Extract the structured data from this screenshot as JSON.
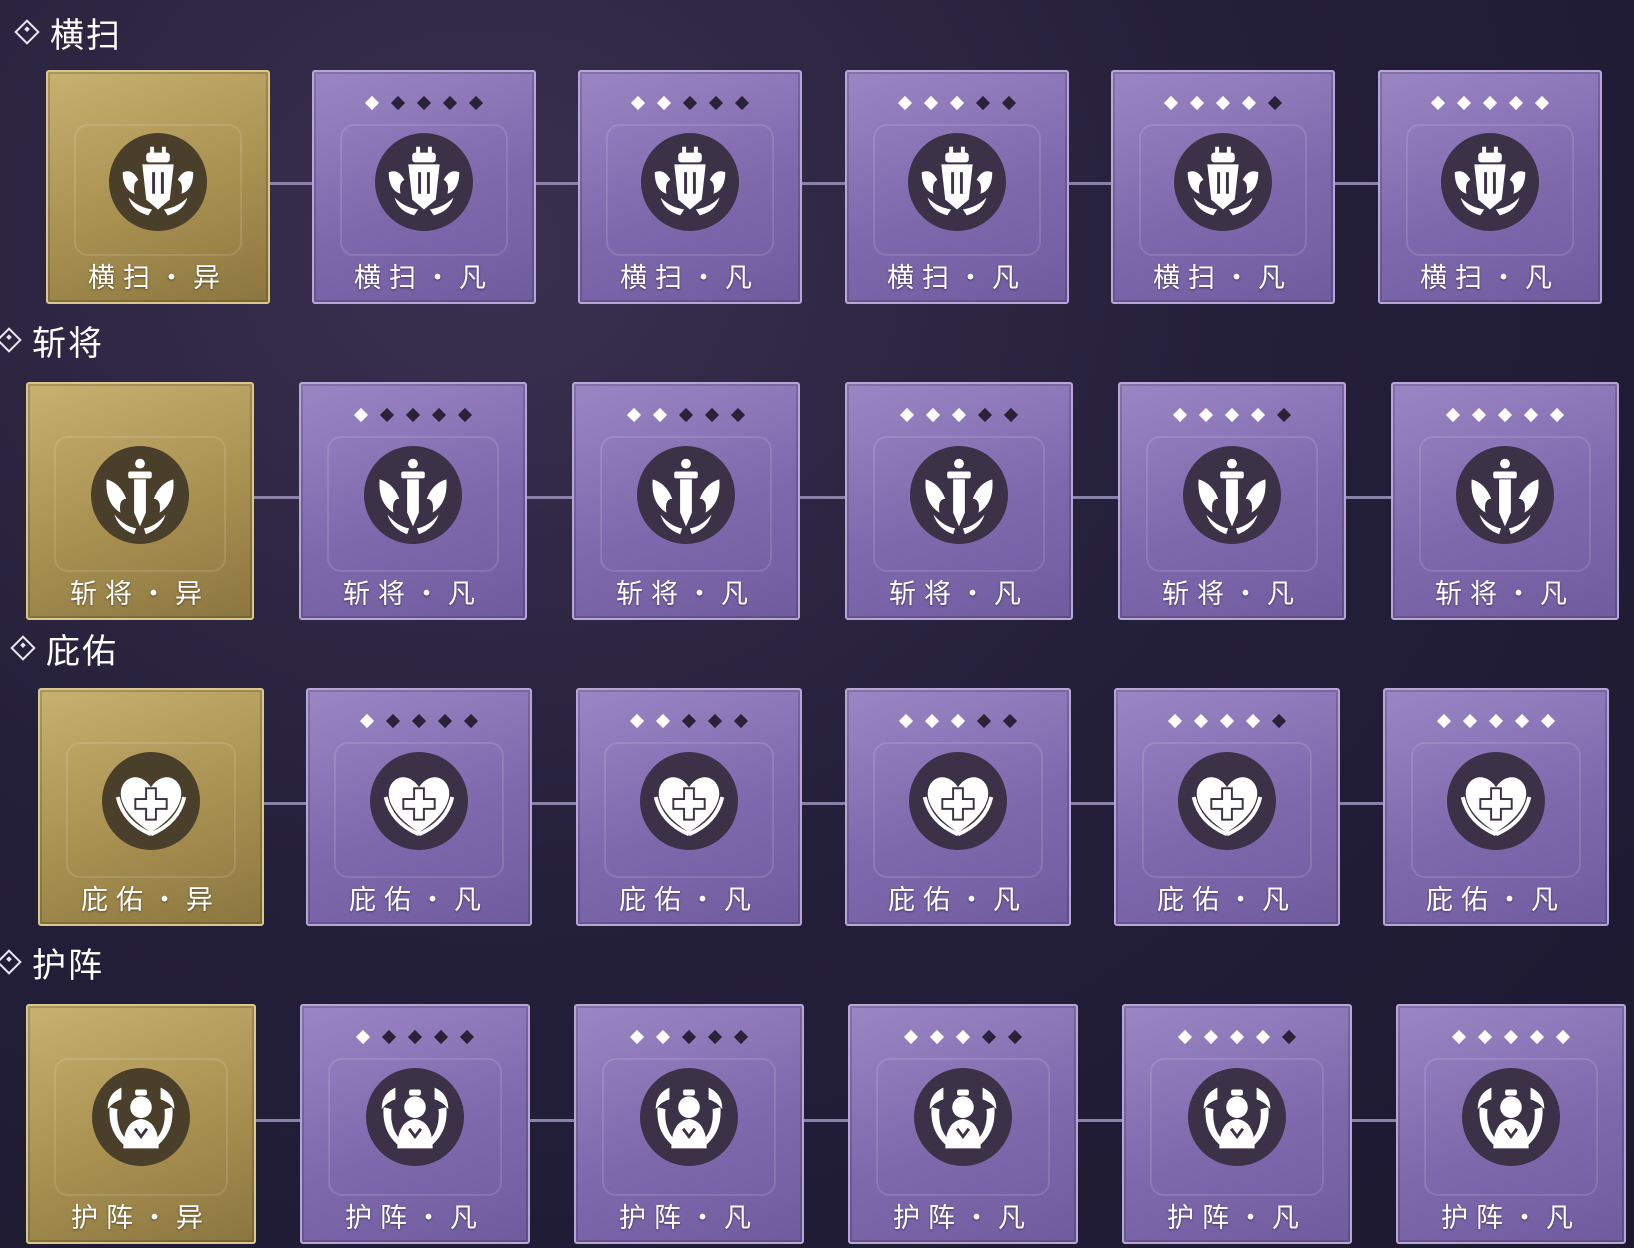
{
  "sections": [
    {
      "title": "横扫",
      "icon": "sweep-helmet-icon",
      "cards": [
        {
          "label": "横扫・异",
          "variant": "gold",
          "stars": null
        },
        {
          "label": "横扫・凡",
          "variant": "purple",
          "stars": 1
        },
        {
          "label": "横扫・凡",
          "variant": "purple",
          "stars": 2
        },
        {
          "label": "横扫・凡",
          "variant": "purple",
          "stars": 3
        },
        {
          "label": "横扫・凡",
          "variant": "purple",
          "stars": 4
        },
        {
          "label": "横扫・凡",
          "variant": "purple",
          "stars": 5
        }
      ]
    },
    {
      "title": "斩将",
      "icon": "sword-flame-icon",
      "cards": [
        {
          "label": "斩将・异",
          "variant": "gold",
          "stars": null
        },
        {
          "label": "斩将・凡",
          "variant": "purple",
          "stars": 1
        },
        {
          "label": "斩将・凡",
          "variant": "purple",
          "stars": 2
        },
        {
          "label": "斩将・凡",
          "variant": "purple",
          "stars": 3
        },
        {
          "label": "斩将・凡",
          "variant": "purple",
          "stars": 4
        },
        {
          "label": "斩将・凡",
          "variant": "purple",
          "stars": 5
        }
      ]
    },
    {
      "title": "庇佑",
      "icon": "heart-cross-icon",
      "cards": [
        {
          "label": "庇佑・异",
          "variant": "gold",
          "stars": null
        },
        {
          "label": "庇佑・凡",
          "variant": "purple",
          "stars": 1
        },
        {
          "label": "庇佑・凡",
          "variant": "purple",
          "stars": 2
        },
        {
          "label": "庇佑・凡",
          "variant": "purple",
          "stars": 3
        },
        {
          "label": "庇佑・凡",
          "variant": "purple",
          "stars": 4
        },
        {
          "label": "庇佑・凡",
          "variant": "purple",
          "stars": 5
        }
      ]
    },
    {
      "title": "护阵",
      "icon": "guardian-figure-icon",
      "cards": [
        {
          "label": "护阵・异",
          "variant": "gold",
          "stars": null
        },
        {
          "label": "护阵・凡",
          "variant": "purple",
          "stars": 1
        },
        {
          "label": "护阵・凡",
          "variant": "purple",
          "stars": 2
        },
        {
          "label": "护阵・凡",
          "variant": "purple",
          "stars": 3
        },
        {
          "label": "护阵・凡",
          "variant": "purple",
          "stars": 4
        },
        {
          "label": "护阵・凡",
          "variant": "purple",
          "stars": 5
        }
      ]
    }
  ],
  "max_stars": 5,
  "colors": {
    "gold_card": "#a89050",
    "purple_card": "#7e69ad",
    "pip_on": "#ffffff",
    "pip_off": "#2a2238"
  }
}
